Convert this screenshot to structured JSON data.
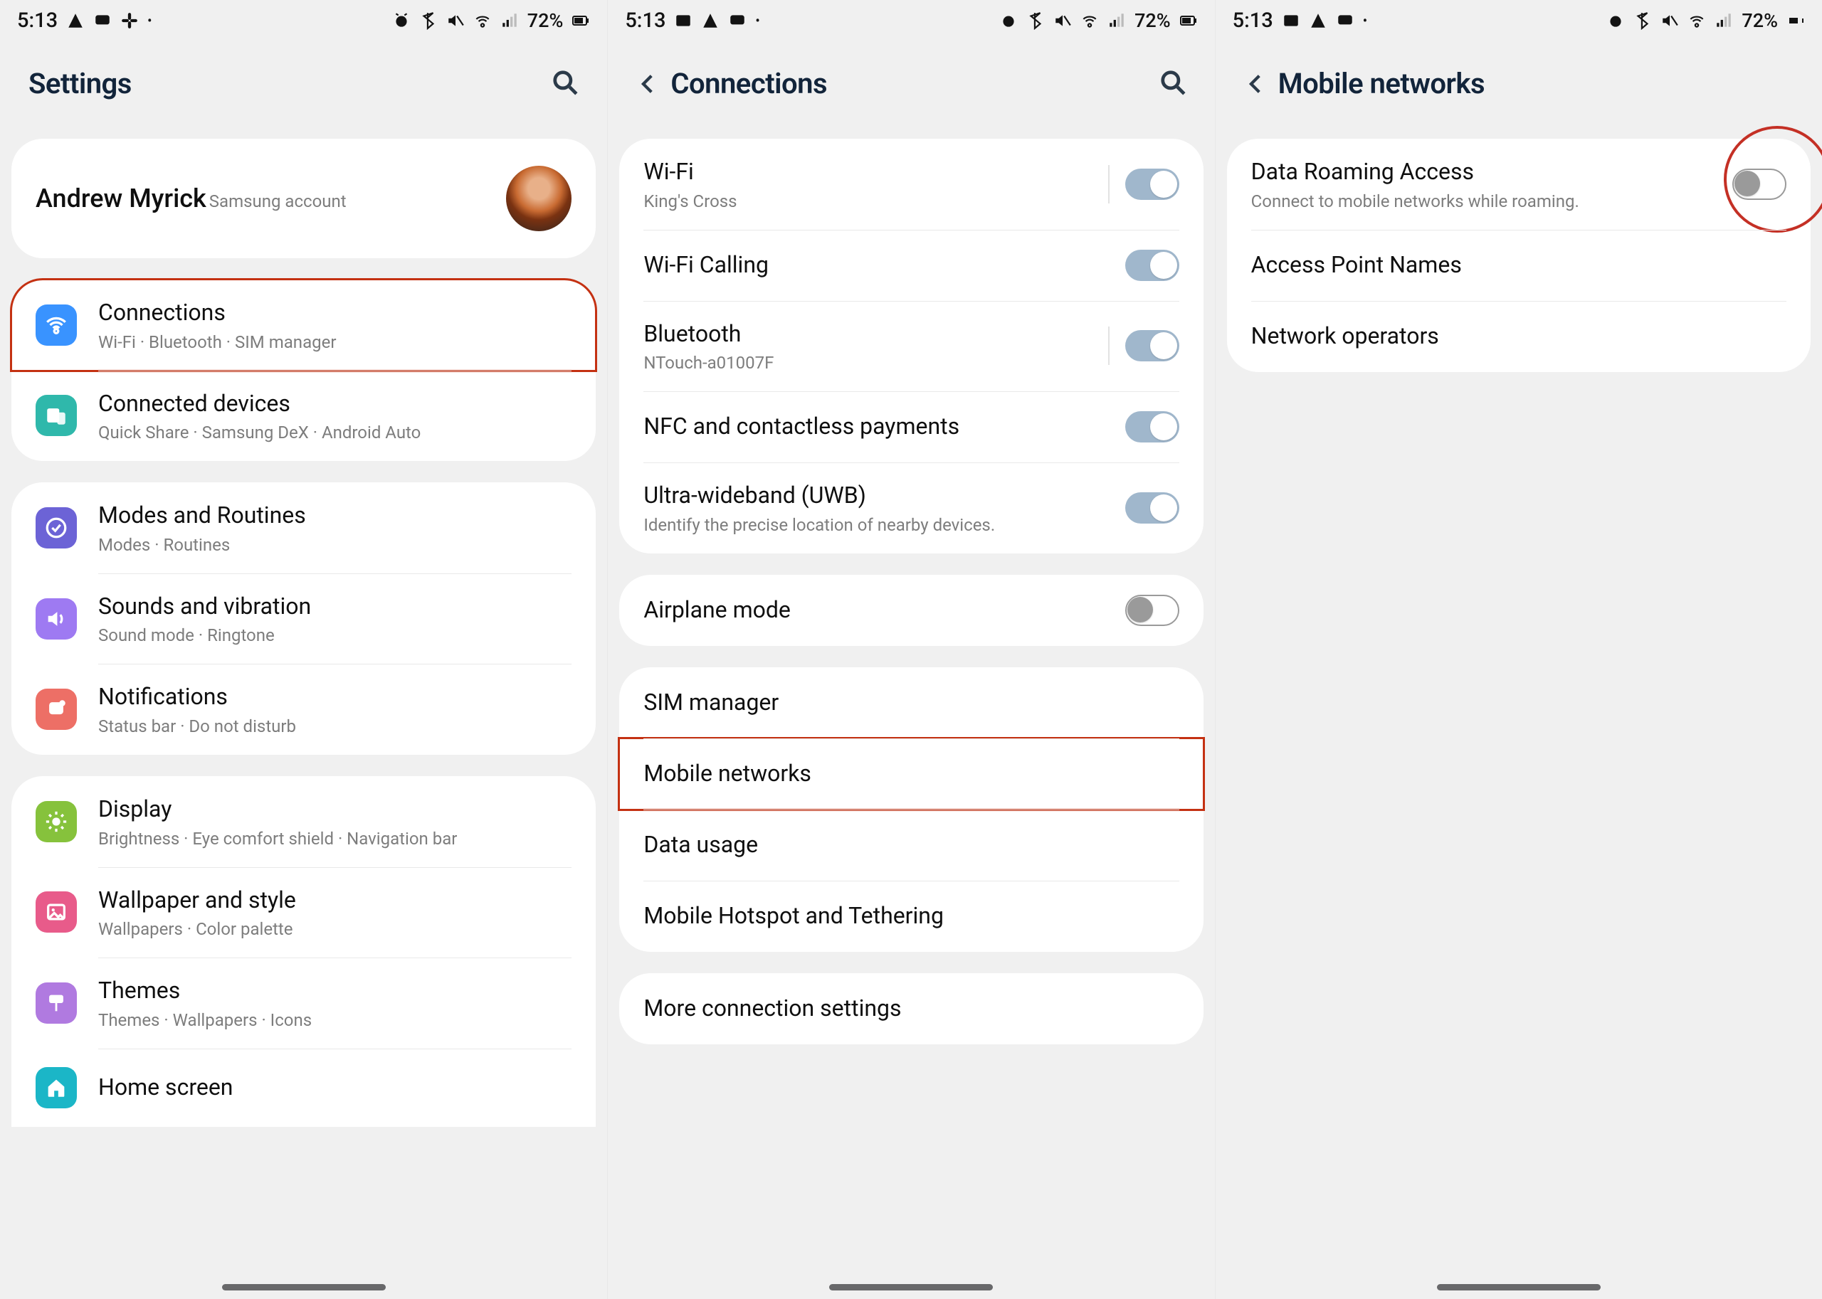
{
  "statusbar": {
    "time": "5:13",
    "battery": "72%"
  },
  "panel1": {
    "title": "Settings",
    "profile": {
      "name": "Andrew Myrick",
      "sub": "Samsung account"
    },
    "group1": [
      {
        "title": "Connections",
        "sub": "Wi-Fi  ·  Bluetooth  ·  SIM manager",
        "color": "#3993ff",
        "icon": "wifi",
        "hl": true
      },
      {
        "title": "Connected devices",
        "sub": "Quick Share  ·  Samsung DeX  ·  Android Auto",
        "color": "#2fb8ab",
        "icon": "devices"
      }
    ],
    "group2": [
      {
        "title": "Modes and Routines",
        "sub": "Modes  ·  Routines",
        "color": "#6c63d6",
        "icon": "check"
      },
      {
        "title": "Sounds and vibration",
        "sub": "Sound mode  ·  Ringtone",
        "color": "#9e7af2",
        "icon": "sound"
      },
      {
        "title": "Notifications",
        "sub": "Status bar  ·  Do not disturb",
        "color": "#ed6f66",
        "icon": "notif"
      }
    ],
    "group3": [
      {
        "title": "Display",
        "sub": "Brightness  ·  Eye comfort shield  ·  Navigation bar",
        "color": "#86c23c",
        "icon": "sun"
      },
      {
        "title": "Wallpaper and style",
        "sub": "Wallpapers  ·  Color palette",
        "color": "#e85b8a",
        "icon": "image"
      },
      {
        "title": "Themes",
        "sub": "Themes  ·  Wallpapers  ·  Icons",
        "color": "#b07ae0",
        "icon": "paint"
      },
      {
        "title": "Home screen",
        "sub": "",
        "color": "#1bb6c7",
        "icon": "home"
      }
    ]
  },
  "panel2": {
    "title": "Connections",
    "group1": [
      {
        "title": "Wi-Fi",
        "sub": "King's Cross",
        "toggle": "on"
      },
      {
        "title": "Wi-Fi Calling",
        "sub": "",
        "toggle": "on"
      },
      {
        "title": "Bluetooth",
        "sub": "NTouch-a01007F",
        "toggle": "on"
      },
      {
        "title": "NFC and contactless payments",
        "sub": "",
        "toggle": "on"
      },
      {
        "title": "Ultra-wideband (UWB)",
        "sub": "Identify the precise location of nearby devices.",
        "toggle": "on"
      }
    ],
    "group2": [
      {
        "title": "Airplane mode",
        "sub": "",
        "toggle": "off"
      }
    ],
    "group3": [
      {
        "title": "SIM manager"
      },
      {
        "title": "Mobile networks",
        "hl": true
      },
      {
        "title": "Data usage"
      },
      {
        "title": "Mobile Hotspot and Tethering"
      }
    ],
    "group4": [
      {
        "title": "More connection settings"
      }
    ]
  },
  "panel3": {
    "title": "Mobile networks",
    "group1": [
      {
        "title": "Data Roaming Access",
        "sub": "Connect to mobile networks while roaming.",
        "toggle": "off",
        "ring": true
      },
      {
        "title": "Access Point Names"
      },
      {
        "title": "Network operators"
      }
    ]
  }
}
